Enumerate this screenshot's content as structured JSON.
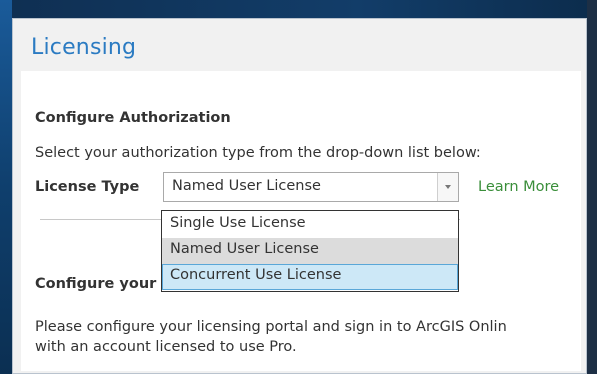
{
  "dialog": {
    "title": "Licensing"
  },
  "authorization": {
    "heading": "Configure Authorization",
    "instructions": "Select your authorization type from the drop-down list below:",
    "license_type_label": "License Type",
    "selected_value": "Named User License",
    "learn_more_label": "Learn More",
    "options": [
      {
        "label": "Single Use License"
      },
      {
        "label": "Named User License",
        "selected": true
      },
      {
        "label": "Concurrent Use License",
        "hovered": true
      }
    ]
  },
  "portal": {
    "heading_visible": "Configure your",
    "description_line1": "Please configure your licensing portal and sign in to ArcGIS Onlin",
    "description_line2": "with an account licensed to use Pro."
  }
}
